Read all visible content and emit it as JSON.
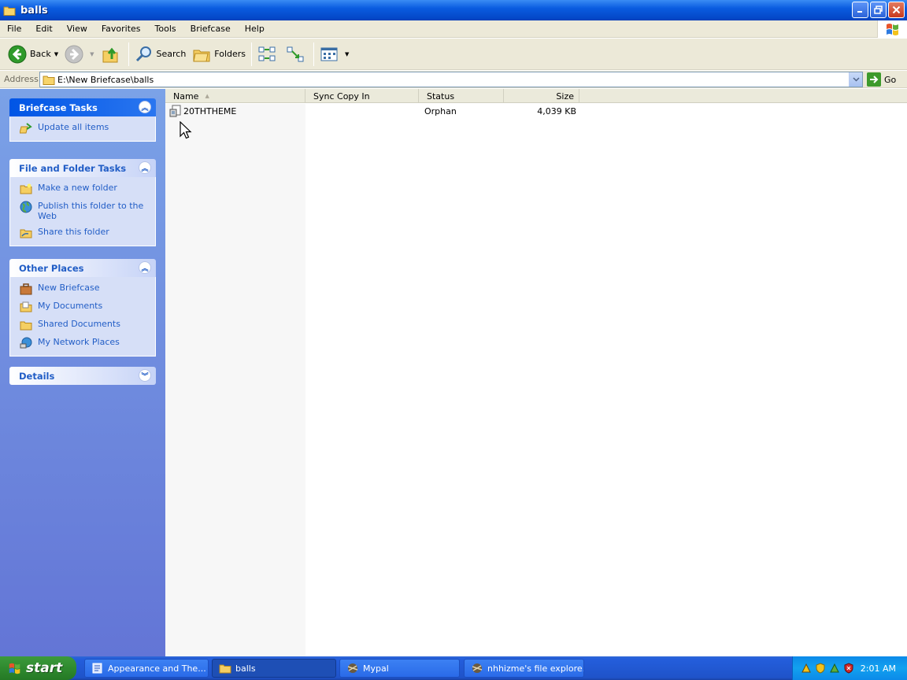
{
  "window": {
    "title": "balls"
  },
  "menu": {
    "items": [
      "File",
      "Edit",
      "View",
      "Favorites",
      "Tools",
      "Briefcase",
      "Help"
    ]
  },
  "toolbar": {
    "back_label": "Back",
    "search_label": "Search",
    "folders_label": "Folders"
  },
  "address": {
    "label": "Address",
    "value": "E:\\New Briefcase\\balls",
    "go_label": "Go"
  },
  "left_pane": {
    "briefcase_tasks": {
      "title": "Briefcase Tasks",
      "items": [
        "Update all items"
      ]
    },
    "file_folder_tasks": {
      "title": "File and Folder Tasks",
      "items": [
        "Make a new folder",
        "Publish this folder to the Web",
        "Share this folder"
      ]
    },
    "other_places": {
      "title": "Other Places",
      "items": [
        "New Briefcase",
        "My Documents",
        "Shared Documents",
        "My Network Places"
      ]
    },
    "details": {
      "title": "Details"
    }
  },
  "list": {
    "columns": [
      "Name",
      "Sync Copy In",
      "Status",
      "Size"
    ],
    "rows": [
      {
        "name": "20THTHEME",
        "sync_copy_in": "",
        "status": "Orphan",
        "size": "4,039 KB"
      }
    ]
  },
  "taskbar": {
    "start_label": "start",
    "tasks": [
      "Appearance and The...",
      "balls",
      "Mypal",
      "nhhizme's file explore..."
    ],
    "clock": "2:01 AM"
  },
  "colors": {
    "title_bar": "#0a5ce0",
    "left_pane": "#6f8fe0",
    "link": "#215dc6",
    "taskbar": "#245edc",
    "start": "#2f8a2f"
  }
}
